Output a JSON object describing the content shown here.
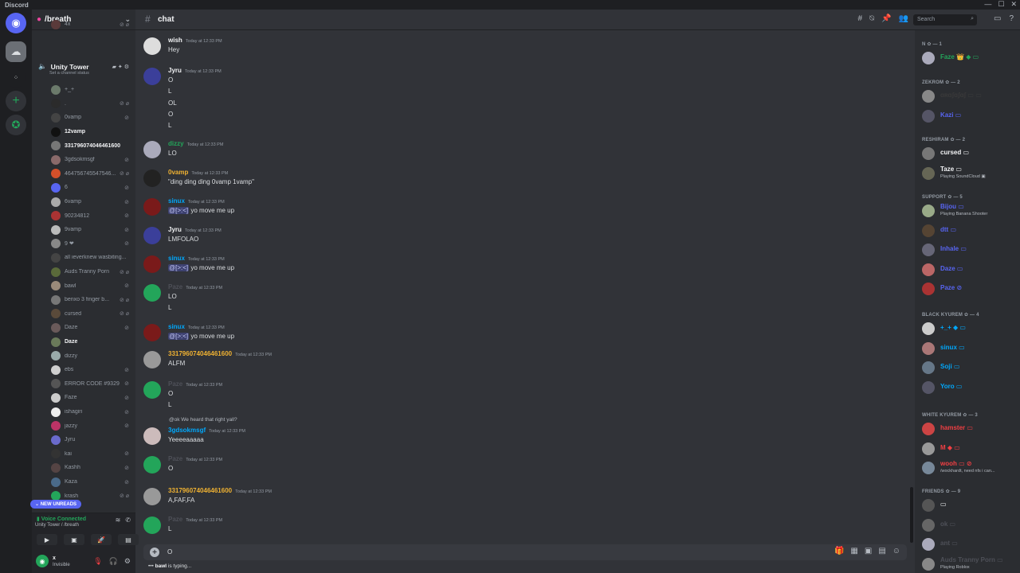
{
  "window": {
    "title": "Discord"
  },
  "guild": {
    "name": "/breath"
  },
  "voice_channel": {
    "name": "Unity Tower",
    "status": "Set a channel status"
  },
  "voice_users": [
    {
      "name": "4x",
      "color": "#5a3a3a",
      "icons": "⊘ ⌀",
      "bold": false
    },
    {
      "name": "+_+",
      "color": "#6b7a6b",
      "icons": "",
      "bold": false
    },
    {
      "name": ".",
      "color": "#2b2b2b",
      "icons": "⊘ ⌀",
      "bold": false
    },
    {
      "name": "0vamp",
      "color": "#444",
      "icons": "⊘",
      "bold": false
    },
    {
      "name": "12vamp",
      "color": "#111",
      "icons": "",
      "bold": true
    },
    {
      "name": "331796074046461600",
      "color": "#777",
      "icons": "",
      "bold": true
    },
    {
      "name": "3gdsokmsgf",
      "color": "#8a6a6a",
      "icons": "⊘",
      "bold": false
    },
    {
      "name": "464756745547546...",
      "color": "#d4502a",
      "icons": "⊘ ⌀",
      "bold": false
    },
    {
      "name": "6",
      "color": "#5865f2",
      "icons": "⊘",
      "bold": false
    },
    {
      "name": "6vamp",
      "color": "#aaa",
      "icons": "⊘",
      "bold": false
    },
    {
      "name": "90234812",
      "color": "#a33",
      "icons": "⊘",
      "bold": false
    },
    {
      "name": "9vamp",
      "color": "#bbb",
      "icons": "⊘",
      "bold": false
    },
    {
      "name": "9 ❤",
      "color": "#888",
      "icons": "⊘",
      "bold": false
    },
    {
      "name": "all ieverknew wasbiting...",
      "color": "#444",
      "icons": "",
      "bold": false
    },
    {
      "name": "Auds Tranny Porn",
      "color": "#5a6a3a",
      "icons": "⊘ ⌀",
      "bold": false
    },
    {
      "name": "bawl",
      "color": "#9a8a7a",
      "icons": "⊘",
      "bold": false
    },
    {
      "name": "benxo 3 finger b...",
      "color": "#777",
      "icons": "⊘ ⌀",
      "bold": false
    },
    {
      "name": "cursed",
      "color": "#5a4a3a",
      "icons": "⊘ ⌀",
      "bold": false
    },
    {
      "name": "Daze",
      "color": "#6a5a5a",
      "icons": "⊘",
      "bold": false
    },
    {
      "name": "Daze",
      "color": "#6a7a5a",
      "icons": "",
      "bold": true
    },
    {
      "name": "dizzy",
      "color": "#9aa",
      "icons": "",
      "bold": false
    },
    {
      "name": "ebs",
      "color": "#cfcfcf",
      "icons": "⊘",
      "bold": false
    },
    {
      "name": "ERROR CODE #9329",
      "color": "#555",
      "icons": "⊘",
      "bold": false
    },
    {
      "name": "Faze",
      "color": "#ccc",
      "icons": "⊘",
      "bold": false
    },
    {
      "name": "ishagiri",
      "color": "#eee",
      "icons": "⊘",
      "bold": false
    },
    {
      "name": "jazzy",
      "color": "#b36",
      "icons": "⊘",
      "bold": false
    },
    {
      "name": "Jyru",
      "color": "#6a6acc",
      "icons": "",
      "bold": false
    },
    {
      "name": "kai",
      "color": "#333",
      "icons": "⊘",
      "bold": false
    },
    {
      "name": "Kashh",
      "color": "#544",
      "icons": "⊘",
      "bold": false
    },
    {
      "name": "Kaza",
      "color": "#4a6a8a",
      "icons": "⊘",
      "bold": false
    },
    {
      "name": "krash",
      "color": "#23a55a",
      "icons": "⊘ ⌀",
      "bold": false
    }
  ],
  "new_unreads": "NEW UNREADS",
  "voice_panel": {
    "status": "Voice Connected",
    "location": "Unity Tower / /breath"
  },
  "user_panel": {
    "name": "x",
    "status": "Invisible"
  },
  "channel": {
    "name": "chat"
  },
  "search": {
    "placeholder": "Search"
  },
  "messages": [
    {
      "author": "wish",
      "color": "#f2f3f5",
      "time": "Today at 12:33 PM",
      "lines": [
        "Hey"
      ],
      "av": "#ddd"
    },
    {
      "author": "Jyru",
      "color": "#f2f3f5",
      "time": "Today at 12:33 PM",
      "lines": [
        "O",
        "L",
        "OL",
        "O",
        "L"
      ],
      "av": "#3b3f9a"
    },
    {
      "author": "dizzy",
      "color": "#23a55a",
      "time": "Today at 12:33 PM",
      "lines": [
        "LO"
      ],
      "av": "#aab"
    },
    {
      "author": "0vamp",
      "color": "#f0b232",
      "time": "Today at 12:33 PM",
      "lines": [
        "\"ding ding ding 0vamp 1vamp\""
      ],
      "av": "#222"
    },
    {
      "author": "sinux",
      "color": "#00a8fc",
      "time": "Today at 12:33 PM",
      "mention": "@[>:<]",
      "lines": [
        "yo move me up"
      ],
      "av": "#7a1a1a"
    },
    {
      "author": "Jyru",
      "color": "#f2f3f5",
      "time": "Today at 12:33 PM",
      "lines": [
        "LMFOLAO"
      ],
      "av": "#3b3f9a"
    },
    {
      "author": "sinux",
      "color": "#00a8fc",
      "time": "Today at 12:33 PM",
      "mention": "@[>:<]",
      "lines": [
        "yo move me up"
      ],
      "av": "#7a1a1a"
    },
    {
      "author": "Paze",
      "color": "#4e5058",
      "time": "Today at 12:33 PM",
      "lines": [
        "LO",
        "L"
      ],
      "av": "#23a55a"
    },
    {
      "author": "sinux",
      "color": "#00a8fc",
      "time": "Today at 12:33 PM",
      "mention": "@[>:<]",
      "lines": [
        "yo move me up"
      ],
      "av": "#7a1a1a"
    },
    {
      "author": "331796074046461600",
      "color": "#f0b232",
      "time": "Today at 12:33 PM",
      "lines": [
        "ALFM"
      ],
      "av": "#999"
    },
    {
      "author": "Paze",
      "color": "#4e5058",
      "time": "Today at 12:33 PM",
      "lines": [
        "O",
        "L"
      ],
      "av": "#23a55a"
    },
    {
      "author": "3gdsokmsgf",
      "color": "#00a8fc",
      "time": "Today at 12:33 PM",
      "reply": "@ok We heard that right yall?",
      "lines": [
        "Yeeeeaaaaa"
      ],
      "av": "#cbb"
    },
    {
      "author": "Paze",
      "color": "#4e5058",
      "time": "Today at 12:33 PM",
      "lines": [
        "O"
      ],
      "av": "#23a55a"
    },
    {
      "author": "331796074046461600",
      "color": "#f0b232",
      "time": "Today at 12:33 PM",
      "lines": [
        "A,FAF,FA"
      ],
      "av": "#999"
    },
    {
      "author": "Paze",
      "color": "#4e5058",
      "time": "Today at 12:33 PM",
      "lines": [
        "L"
      ],
      "av": "#23a55a"
    }
  ],
  "composer": {
    "value": "O"
  },
  "typing": {
    "user": "bawl",
    "suffix": "is typing..."
  },
  "member_sections": [
    {
      "title": "N ✿ — 1",
      "members": [
        {
          "name": "Faze 👑 ◆ ▭",
          "color": "#23a55a",
          "status": ""
        }
      ]
    },
    {
      "title": "ZEKROM ✿ — 2",
      "members": [
        {
          "name": "ɑʀɑʃɑʃɑʃ ▭ ▭",
          "color": "#3a3a3a",
          "status": ""
        },
        {
          "name": "Kazi ▭",
          "color": "#5865f2",
          "status": ""
        }
      ]
    },
    {
      "title": "RESHIRAM ✿ — 2",
      "members": [
        {
          "name": "cursed ▭",
          "color": "#f2f3f5",
          "status": ""
        },
        {
          "name": "Taze ▭",
          "color": "#f2f3f5",
          "status": "Playing SoundCloud ▣"
        }
      ]
    },
    {
      "title": "SUPPORT ✿ — 5",
      "members": [
        {
          "name": "Bijou ▭",
          "color": "#5865f2",
          "status": "Playing Banana Shooter"
        },
        {
          "name": "dtt ▭",
          "color": "#5865f2",
          "status": ""
        },
        {
          "name": "Inhale ▭",
          "color": "#5865f2",
          "status": ""
        },
        {
          "name": "Daze ▭",
          "color": "#5865f2",
          "status": ""
        },
        {
          "name": "Paze ⊘",
          "color": "#5865f2",
          "status": ""
        }
      ]
    },
    {
      "title": "BLACK KYUREM ✿ — 4",
      "members": [
        {
          "name": "+_+ ◆ ▭",
          "color": "#00a8fc",
          "status": ""
        },
        {
          "name": "sinux ▭",
          "color": "#00a8fc",
          "status": ""
        },
        {
          "name": "Soji ▭",
          "color": "#00a8fc",
          "status": ""
        },
        {
          "name": "Yoro ▭",
          "color": "#00a8fc",
          "status": ""
        }
      ]
    },
    {
      "title": "WHITE KYUREM ✿ — 3",
      "members": [
        {
          "name": "hamster ▭",
          "color": "#f23f43",
          "status": ""
        },
        {
          "name": "M ◆ ▭",
          "color": "#f23f43",
          "status": ""
        },
        {
          "name": "wooh ▭ ⊘",
          "color": "#f23f43",
          "status": "/wockhardt, need nfs i can..."
        }
      ]
    },
    {
      "title": "FRIENDS ✿ — 9",
      "members": [
        {
          "name": "▭",
          "color": "#f2f3f5",
          "status": ""
        },
        {
          "name": "ok ▭",
          "color": "#4e5058",
          "status": ""
        },
        {
          "name": "ant ▭",
          "color": "#4e5058",
          "status": ""
        },
        {
          "name": "Auds Tranny Porn ▭",
          "color": "#4e5058",
          "status": "Playing Roblox"
        }
      ]
    }
  ]
}
